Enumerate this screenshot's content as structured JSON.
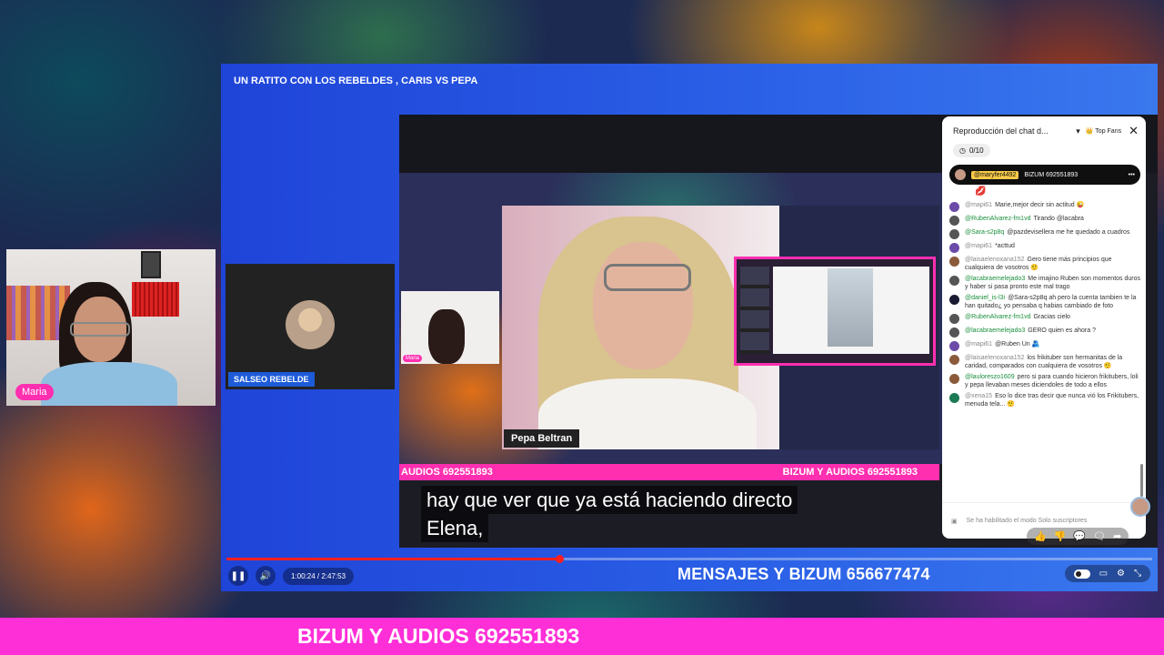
{
  "webcam": {
    "name_tag": "Maria"
  },
  "player": {
    "title": "UN RATITO CON LOS REBELDES , CARIS VS PEPA",
    "participants": {
      "salseo_label": "SALSEO REBELDE",
      "small_cam_tag": "Maria",
      "pepa_name": "Pepa Beltran"
    },
    "pink_bar": {
      "left": "AUDIOS 692551893",
      "right": "BIZUM Y AUDIOS 692551893"
    },
    "subtitle": {
      "line1": "hay que ver que ya está haciendo directo",
      "line2": "Elena,"
    },
    "ticker": "MENSAJES Y BIZUM 656677474",
    "time": "1:00:24 / 2:47:53",
    "progress_fraction": 0.36
  },
  "chat": {
    "title": "Reproducción del chat d...",
    "top_fans": "Top Fans",
    "counter": "0/10",
    "pinned": {
      "user": "@maryfer4492",
      "message": "BIZUM 692551893"
    },
    "footer_text": "Se ha habilitado el modo Solo suscriptores",
    "messages": [
      {
        "user": "@mapi61",
        "text": "Marie,mejor decir sin actitud 😜"
      },
      {
        "user": "@RubenAlvarez-fm1vd",
        "text": "Tirando @lacabra"
      },
      {
        "user": "@Sara-s2p8q",
        "text": "@pazdevisellera me he quedado a cuadros"
      },
      {
        "user": "@mapi61",
        "text": "*acttud"
      },
      {
        "user": "@laisaelenoxana152",
        "text": "Gero tiene más principios que cualquiera de vosotros 🤨"
      },
      {
        "user": "@lacabraemelejado3",
        "text": "Me imajino Ruben son momentos duros y haber si pasa pronto este mal trago"
      },
      {
        "user": "@daniel_is-l3i",
        "text": "@Sara-s2p8q ah pero la cuenta tambien te la han quitado¿ yo pensaba q habias cambiado de foto"
      },
      {
        "user": "@RubenAlvarez-fm1vd",
        "text": "Gracias cielo"
      },
      {
        "user": "@lacabraemelejado3",
        "text": "GERO quien es ahora ?"
      },
      {
        "user": "@mapi61",
        "text": "@Ruben Un 🫂"
      },
      {
        "user": "@laisaelenoxana152",
        "text": "los frikituber son hermanitas de la caridad, comparados con cualquiera de vosotros 🤨"
      },
      {
        "user": "@lauloreszo1609",
        "text": "pero si para cuando hicieron frikitubers, loli y pepa llevaban meses diciendoles de todo a ellos"
      },
      {
        "user": "@xena15",
        "text": "Eso lo dice tras decir que nunca vió los Frikitubers, menuda tela... 🤨"
      }
    ]
  },
  "bottom_banner": "BIZUM Y AUDIOS 692551893",
  "colors": {
    "accent_pink": "#ff2fd8",
    "player_blue": "#2a5fe6",
    "progress_red": "#ff1f1f"
  }
}
